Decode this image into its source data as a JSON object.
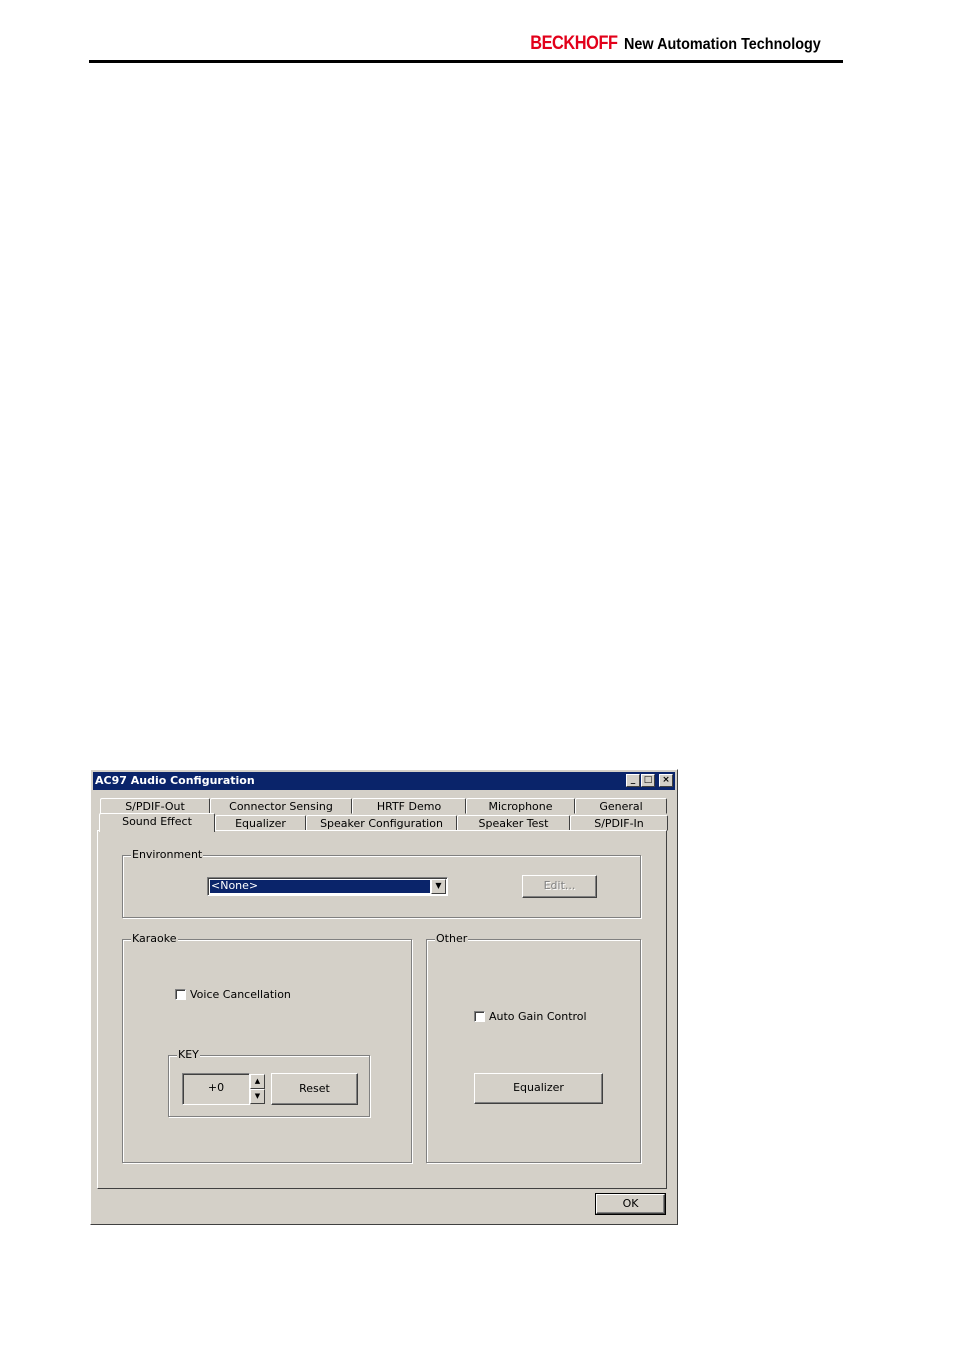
{
  "header": {
    "brand": "BECKHOFF",
    "tagline": "New Automation Technology"
  },
  "dialog": {
    "title": "AC97 Audio Configuration",
    "window_buttons": {
      "minimize": "_",
      "maximize": "□",
      "close": "×"
    },
    "tabs_back": [
      "S/PDIF-Out",
      "Connector Sensing",
      "HRTF Demo",
      "Microphone",
      "General"
    ],
    "tabs_front": [
      "Sound Effect",
      "Equalizer",
      "Speaker Configuration",
      "Speaker Test",
      "S/PDIF-In"
    ],
    "active_tab": "Sound Effect",
    "environment": {
      "legend": "Environment",
      "selected": "<None>",
      "edit_label": "Edit..."
    },
    "karaoke": {
      "legend": "Karaoke",
      "voice_cancellation_label": "Voice Cancellation",
      "voice_cancellation_checked": false,
      "key": {
        "legend": "KEY",
        "value": "+0",
        "reset_label": "Reset"
      }
    },
    "other": {
      "legend": "Other",
      "auto_gain_label": "Auto Gain Control",
      "auto_gain_checked": false,
      "equalizer_label": "Equalizer"
    },
    "ok_label": "OK"
  }
}
